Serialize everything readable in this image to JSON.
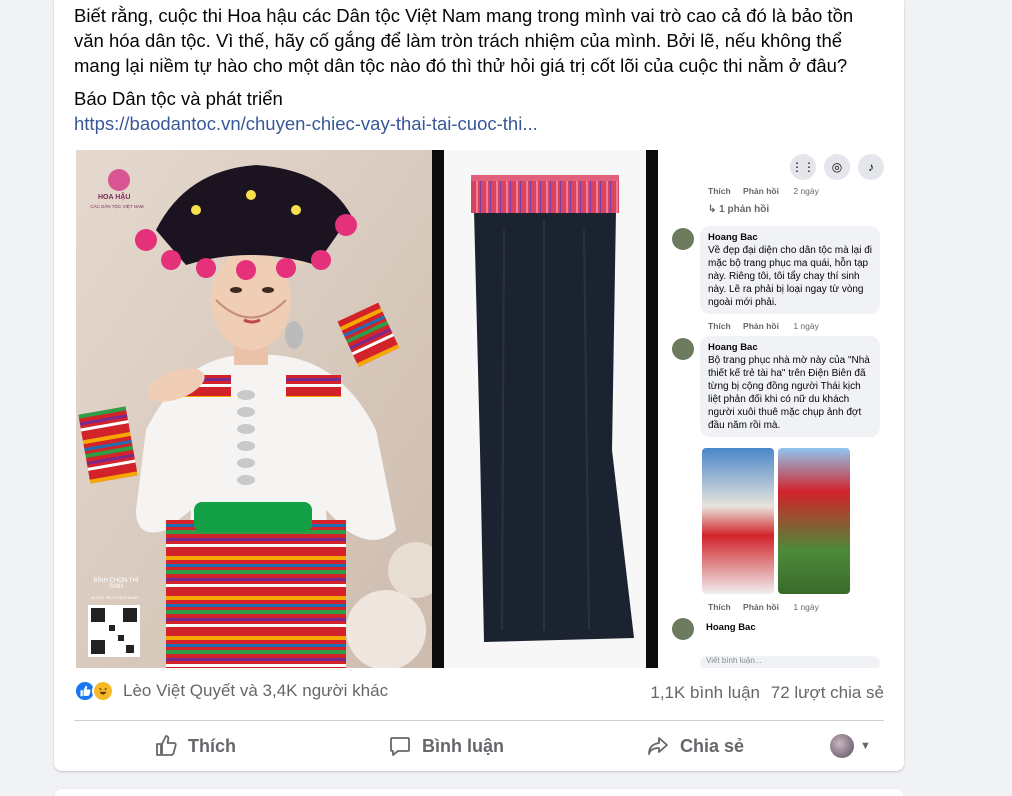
{
  "post": {
    "body": "Biết rằng, cuộc thi Hoa hậu các Dân tộc Việt Nam mang trong mình vai trò cao cả đó là bảo tồn văn hóa dân tộc. Vì thế, hãy cố gắng để làm tròn trách nhiệm của mình. Bởi lẽ, nếu không thể mang lại niềm tự hào cho một dân tộc nào đó thì thử hỏi giá trị cốt lõi của cuộc thi nằm ở đâu?",
    "source": "Báo Dân tộc và phát triển",
    "link": "https://baodantoc.vn/chuyen-chiec-vay-thai-tai-cuoc-thi..."
  },
  "poster": {
    "logo_text": "HOA HẬU",
    "logo_sub": "CÁC DÂN TỘC VIỆT NAM",
    "vote_text": "BÌNH CHỌN THÍ SINH",
    "vote_sub": "ĐƯỢC YÊU THÍCH NHẤT"
  },
  "screenshot_comments": {
    "top_meta": {
      "like": "Thích",
      "reply": "Phản hồi",
      "time": "2 ngày"
    },
    "replies_link": "↳ 1 phản hồi",
    "comments": [
      {
        "author": "Hoang Bac",
        "text": "Về đẹp đại diện cho dân tộc mà lại đi mặc bộ trang phục ma quái, hỗn tạp này. Riêng tôi, tôi tẩy chay thí sinh này. Lẽ ra phải bị loại ngay từ vòng ngoài mới phải.",
        "like": "Thích",
        "reply": "Phản hồi",
        "time": "1 ngày"
      },
      {
        "author": "Hoang Bac",
        "text": "Bộ trang phục nhà mờ này của \"Nhà thiết kế trẻ tài ha\" trên Điện Biên đã từng bị cộng đồng người Thái kịch liệt phản đối khi có nữ du khách người xuôi thuê mặc chụp ảnh đợt đầu năm rồi mà.",
        "like": "Thích",
        "reply": "Phản hồi",
        "time": "1 ngày"
      },
      {
        "author": "Hoang Bac"
      }
    ],
    "input_placeholder": "Viết bình luận..."
  },
  "stats": {
    "reactions_text": "Lèo Việt Quyết và 3,4K người khác",
    "comments": "1,1K bình luận",
    "shares": "72 lượt chia sẻ"
  },
  "actions": {
    "like": "Thích",
    "comment": "Bình luận",
    "share": "Chia sẻ"
  },
  "colors": {
    "link": "#385898",
    "like_blue": "#1877f2",
    "secondary_text": "#65676b"
  }
}
